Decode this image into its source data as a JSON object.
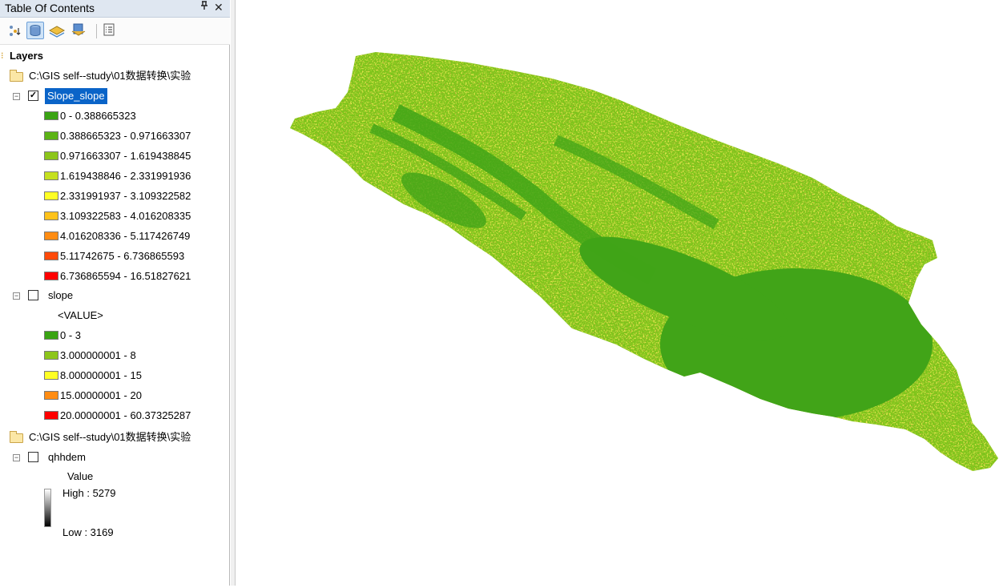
{
  "toc": {
    "title": "Table Of Contents",
    "pin_glyph": "ᵖ",
    "close_glyph": "✕",
    "toolbar": [
      {
        "name": "list-by-drawing-order-icon"
      },
      {
        "name": "list-by-source-icon"
      },
      {
        "name": "list-by-visibility-icon"
      },
      {
        "name": "list-by-selection-icon"
      },
      {
        "name": "options-icon"
      }
    ],
    "root_label": "Layers",
    "groups": [
      {
        "path": "C:\\GIS  self--study\\01数据转换\\实验",
        "layers": [
          {
            "name": "Slope_slope",
            "checked": true,
            "selected": true,
            "classes": [
              {
                "label": "0 - 0.388665323",
                "color": "#3aa313"
              },
              {
                "label": "0.388665323 - 0.971663307",
                "color": "#5cb315"
              },
              {
                "label": "0.971663307 - 1.619438845",
                "color": "#8cc51a"
              },
              {
                "label": "1.619438846 - 2.331991936",
                "color": "#c5e01f"
              },
              {
                "label": "2.331991937 - 3.109322582",
                "color": "#ffff24"
              },
              {
                "label": "3.109322583 - 4.016208335",
                "color": "#ffc21a"
              },
              {
                "label": "4.016208336 - 5.117426749",
                "color": "#ff8c12"
              },
              {
                "label": "5.11742675 - 6.736865593",
                "color": "#ff4a0a"
              },
              {
                "label": "6.736865594 - 16.51827621",
                "color": "#ff0000"
              }
            ]
          },
          {
            "name": "slope",
            "checked": false,
            "selected": false,
            "field_label": "<VALUE>",
            "classes": [
              {
                "label": "0 - 3",
                "color": "#3aa313"
              },
              {
                "label": "3.000000001 - 8",
                "color": "#8cc51a"
              },
              {
                "label": "8.000000001 - 15",
                "color": "#ffff24"
              },
              {
                "label": "15.00000001 - 20",
                "color": "#ff8c12"
              },
              {
                "label": "20.00000001 - 60.37325287",
                "color": "#ff0000"
              }
            ]
          }
        ]
      },
      {
        "path": "C:\\GIS  self--study\\01数据转换\\实验",
        "layers": [
          {
            "name": "qhhdem",
            "checked": false,
            "selected": false,
            "stretch": {
              "field_label": "Value",
              "high": "High : 5279",
              "low": "Low : 3169"
            }
          }
        ]
      }
    ]
  },
  "map": {
    "description_colors": {
      "base": "#41a418",
      "light_green": "#7cc41a",
      "yellow": "#d6e41d",
      "orange": "#f4a31a",
      "red": "#e4361a"
    }
  }
}
